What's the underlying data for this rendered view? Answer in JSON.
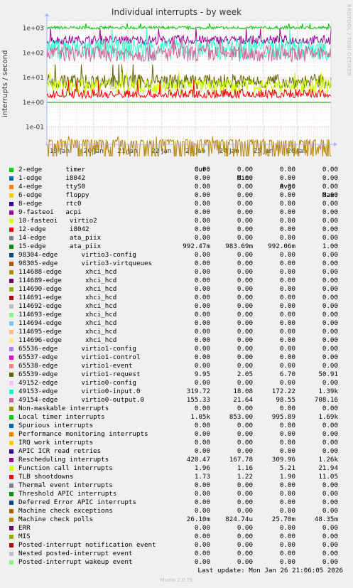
{
  "header": {
    "title": "Individual interrupts - by week",
    "side_tag": "RRDTOOL / TOBI OETIKER",
    "footer": "Munin 2.0.75",
    "last_update": "Last update: Mon Jan 26 21:06:05 2026"
  },
  "chart_data": {
    "type": "line",
    "title": "Individual interrupts - by week",
    "ylabel": "interrupts / second",
    "yscale": "log",
    "ylim": [
      0.02,
      2000
    ],
    "y_ticks": [
      "1e+03",
      "1e+02",
      "1e+01",
      "1e+00",
      "1e-01"
    ],
    "x_ticks": [
      "19 Jan",
      "20 Jan",
      "21 Jan",
      "22 Jan",
      "23 Jan",
      "24 Jan",
      "25 Jan",
      "26 Jan"
    ],
    "grid": true,
    "series": [
      {
        "name": "Local timer interrupts",
        "color": "#00cc00",
        "min": 853.0,
        "avg": 995.89,
        "max": 1690
      },
      {
        "name": "Rescheduling interrupts",
        "color": "#990099",
        "min": 167.78,
        "avg": 309.96,
        "max": 1260
      },
      {
        "name": "virtio0-input.0",
        "color": "#33ffcc",
        "min": 18.08,
        "avg": 172.22,
        "max": 1390
      },
      {
        "name": "virtio0-output.0",
        "color": "#cc6699",
        "min": 21.64,
        "avg": 98.55,
        "max": 708.16
      },
      {
        "name": "virtio1-request",
        "color": "#666600",
        "min": 2.05,
        "avg": 6.7,
        "max": 50.91
      },
      {
        "name": "Function call interrupts",
        "color": "#ccff00",
        "min": 1.16,
        "avg": 5.21,
        "max": 21.94
      },
      {
        "name": "TLB shootdowns",
        "color": "#ff0000",
        "min": 1.22,
        "avg": 1.9,
        "max": 11.05
      },
      {
        "name": "ata_piix",
        "color": "#008f00",
        "min": 0.98369,
        "avg": 0.99206,
        "max": 1.0
      },
      {
        "name": "Machine check polls",
        "color": "#b8860b",
        "min": 0.00082474,
        "avg": 0.0257,
        "max": 0.04835
      }
    ]
  },
  "legend": {
    "columns": [
      "Cur:",
      "Min:",
      "Avg:",
      "Max:"
    ],
    "rows": [
      {
        "name": "2-edge      timer",
        "color": "#00cc00",
        "cur": "0.00",
        "min": "0.00",
        "avg": "0.00",
        "max": "0.00"
      },
      {
        "name": "1-edge      i8042",
        "color": "#0066b3",
        "cur": "0.00",
        "min": "0.00",
        "avg": "0.00",
        "max": "0.00"
      },
      {
        "name": "4-edge      ttyS0",
        "color": "#ff8000",
        "cur": "0.00",
        "min": "0.00",
        "avg": "0.00",
        "max": "0.00"
      },
      {
        "name": "6-edge      floppy",
        "color": "#ffcc00",
        "cur": "0.00",
        "min": "0.00",
        "avg": "0.00",
        "max": "0.00"
      },
      {
        "name": "8-edge      rtc0",
        "color": "#330099",
        "cur": "0.00",
        "min": "0.00",
        "avg": "0.00",
        "max": "0.00"
      },
      {
        "name": "9-fasteoi   acpi",
        "color": "#990099",
        "cur": "0.00",
        "min": "0.00",
        "avg": "0.00",
        "max": "0.00"
      },
      {
        "name": "10-fasteoi   virtio2",
        "color": "#ccff00",
        "cur": "0.00",
        "min": "0.00",
        "avg": "0.00",
        "max": "0.00"
      },
      {
        "name": "12-edge      i8042",
        "color": "#ff0000",
        "cur": "0.00",
        "min": "0.00",
        "avg": "0.00",
        "max": "0.00"
      },
      {
        "name": "14-edge      ata_piix",
        "color": "#808080",
        "cur": "0.00",
        "min": "0.00",
        "avg": "0.00",
        "max": "0.00"
      },
      {
        "name": "15-edge      ata_piix",
        "color": "#008f00",
        "cur": "992.47m",
        "min": "983.69m",
        "avg": "992.06m",
        "max": "1.00"
      },
      {
        "name": "98304-edge      virtio3-config",
        "color": "#00487d",
        "cur": "0.00",
        "min": "0.00",
        "avg": "0.00",
        "max": "0.00"
      },
      {
        "name": "98305-edge      virtio3-virtqueues",
        "color": "#b35a00",
        "cur": "0.00",
        "min": "0.00",
        "avg": "0.00",
        "max": "0.00"
      },
      {
        "name": "114688-edge      xhci_hcd",
        "color": "#b38f00",
        "cur": "0.00",
        "min": "0.00",
        "avg": "0.00",
        "max": "0.00"
      },
      {
        "name": "114689-edge      xhci_hcd",
        "color": "#6b006b",
        "cur": "0.00",
        "min": "0.00",
        "avg": "0.00",
        "max": "0.00"
      },
      {
        "name": "114690-edge      xhci_hcd",
        "color": "#8fb300",
        "cur": "0.00",
        "min": "0.00",
        "avg": "0.00",
        "max": "0.00"
      },
      {
        "name": "114691-edge      xhci_hcd",
        "color": "#b30000",
        "cur": "0.00",
        "min": "0.00",
        "avg": "0.00",
        "max": "0.00"
      },
      {
        "name": "114692-edge      xhci_hcd",
        "color": "#bebebe",
        "cur": "0.00",
        "min": "0.00",
        "avg": "0.00",
        "max": "0.00"
      },
      {
        "name": "114693-edge      xhci_hcd",
        "color": "#80ff80",
        "cur": "0.00",
        "min": "0.00",
        "avg": "0.00",
        "max": "0.00"
      },
      {
        "name": "114694-edge      xhci_hcd",
        "color": "#80c9ff",
        "cur": "0.00",
        "min": "0.00",
        "avg": "0.00",
        "max": "0.00"
      },
      {
        "name": "114695-edge      xhci_hcd",
        "color": "#ffc080",
        "cur": "0.00",
        "min": "0.00",
        "avg": "0.00",
        "max": "0.00"
      },
      {
        "name": "114696-edge      xhci_hcd",
        "color": "#ffe680",
        "cur": "0.00",
        "min": "0.00",
        "avg": "0.00",
        "max": "0.00"
      },
      {
        "name": "65536-edge      virtio1-config",
        "color": "#aa80ff",
        "cur": "0.00",
        "min": "0.00",
        "avg": "0.00",
        "max": "0.00"
      },
      {
        "name": "65537-edge      virtio1-control",
        "color": "#ee00cc",
        "cur": "0.00",
        "min": "0.00",
        "avg": "0.00",
        "max": "0.00"
      },
      {
        "name": "65538-edge      virtio1-event",
        "color": "#ff8080",
        "cur": "0.00",
        "min": "0.00",
        "avg": "0.00",
        "max": "0.00"
      },
      {
        "name": "65539-edge      virtio1-request",
        "color": "#666600",
        "cur": "9.95",
        "min": "2.05",
        "avg": "6.70",
        "max": "50.91"
      },
      {
        "name": "49152-edge      virtio0-config",
        "color": "#ffbfff",
        "cur": "0.00",
        "min": "0.00",
        "avg": "0.00",
        "max": "0.00"
      },
      {
        "name": "49153-edge      virtio0-input.0",
        "color": "#00ffcc",
        "cur": "319.72",
        "min": "18.08",
        "avg": "172.22",
        "max": "1.39k"
      },
      {
        "name": "49154-edge      virtio0-output.0",
        "color": "#cc6699",
        "cur": "155.33",
        "min": "21.64",
        "avg": "98.55",
        "max": "708.16"
      },
      {
        "name": "Non-maskable interrupts",
        "color": "#999900",
        "cur": "0.00",
        "min": "0.00",
        "avg": "0.00",
        "max": "0.00"
      },
      {
        "name": "Local timer interrupts",
        "color": "#00cc00",
        "cur": "1.05k",
        "min": "853.00",
        "avg": "995.89",
        "max": "1.69k"
      },
      {
        "name": "Spurious interrupts",
        "color": "#0066b3",
        "cur": "0.00",
        "min": "0.00",
        "avg": "0.00",
        "max": "0.00"
      },
      {
        "name": "Performance monitoring interrupts",
        "color": "#ff8000",
        "cur": "0.00",
        "min": "0.00",
        "avg": "0.00",
        "max": "0.00"
      },
      {
        "name": "IRQ work interrupts",
        "color": "#ffcc00",
        "cur": "0.00",
        "min": "0.00",
        "avg": "0.00",
        "max": "0.00"
      },
      {
        "name": "APIC ICR read retries",
        "color": "#330099",
        "cur": "0.00",
        "min": "0.00",
        "avg": "0.00",
        "max": "0.00"
      },
      {
        "name": "Rescheduling interrupts",
        "color": "#990099",
        "cur": "420.47",
        "min": "167.78",
        "avg": "309.96",
        "max": "1.26k"
      },
      {
        "name": "Function call interrupts",
        "color": "#ccff00",
        "cur": "1.96",
        "min": "1.16",
        "avg": "5.21",
        "max": "21.94"
      },
      {
        "name": "TLB shootdowns",
        "color": "#ff0000",
        "cur": "1.73",
        "min": "1.22",
        "avg": "1.90",
        "max": "11.05"
      },
      {
        "name": "Thermal event interrupts",
        "color": "#808080",
        "cur": "0.00",
        "min": "0.00",
        "avg": "0.00",
        "max": "0.00"
      },
      {
        "name": "Threshold APIC interrupts",
        "color": "#008f00",
        "cur": "0.00",
        "min": "0.00",
        "avg": "0.00",
        "max": "0.00"
      },
      {
        "name": "Deferred Error APIC interrupts",
        "color": "#00487d",
        "cur": "0.00",
        "min": "0.00",
        "avg": "0.00",
        "max": "0.00"
      },
      {
        "name": "Machine check exceptions",
        "color": "#b35a00",
        "cur": "0.00",
        "min": "0.00",
        "avg": "0.00",
        "max": "0.00"
      },
      {
        "name": "Machine check polls",
        "color": "#b38f00",
        "cur": "26.10m",
        "min": "824.74u",
        "avg": "25.70m",
        "max": "48.35m"
      },
      {
        "name": "ERR",
        "color": "#6b006b",
        "cur": "0.00",
        "min": "0.00",
        "avg": "0.00",
        "max": "0.00"
      },
      {
        "name": "MIS",
        "color": "#8fb300",
        "cur": "0.00",
        "min": "0.00",
        "avg": "0.00",
        "max": "0.00"
      },
      {
        "name": "Posted-interrupt notification event",
        "color": "#b30000",
        "cur": "0.00",
        "min": "0.00",
        "avg": "0.00",
        "max": "0.00"
      },
      {
        "name": "Nested posted-interrupt event",
        "color": "#bebebe",
        "cur": "0.00",
        "min": "0.00",
        "avg": "0.00",
        "max": "0.00"
      },
      {
        "name": "Posted-interrupt wakeup event",
        "color": "#80ff80",
        "cur": "0.00",
        "min": "0.00",
        "avg": "0.00",
        "max": "0.00"
      }
    ]
  }
}
